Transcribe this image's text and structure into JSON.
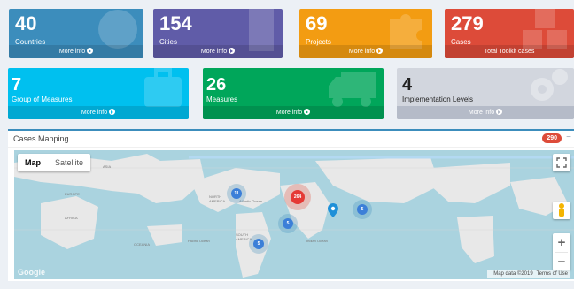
{
  "boxes": {
    "countries": {
      "value": "40",
      "label": "Countries",
      "footer": "More info"
    },
    "cities": {
      "value": "154",
      "label": "Cities",
      "footer": "More info"
    },
    "projects": {
      "value": "69",
      "label": "Projects",
      "footer": "More info"
    },
    "cases": {
      "value": "279",
      "label": "Cases",
      "footer": "Total Toolkit cases"
    },
    "group": {
      "value": "7",
      "label": "Group of Measures",
      "footer": "More info"
    },
    "measures": {
      "value": "26",
      "label": "Measures",
      "footer": "More info"
    },
    "levels": {
      "value": "4",
      "label": "Implementation Levels",
      "footer": "More info"
    }
  },
  "panel": {
    "title": "Cases Mapping",
    "badge": "290",
    "minimize": "−"
  },
  "map": {
    "tabs": [
      "Map",
      "Satellite"
    ],
    "zoom_in": "+",
    "zoom_out": "−",
    "logo": "Google",
    "attribution": "Map data ©2019",
    "terms": "Terms of Use",
    "markers": [
      {
        "label": "11"
      },
      {
        "label": "264"
      },
      {
        "label": "5"
      },
      {
        "label": "5"
      },
      {
        "label": "5"
      }
    ],
    "labels": {
      "asia": "ASIA",
      "europe": "EUROPE",
      "africa": "AFRICA",
      "north_america": "NORTH AMERICA",
      "south_america": "SOUTH AMERICA",
      "atlantic": "Atlantic Ocean",
      "indian": "Indian Ocean",
      "oceania": "OCEANIA",
      "pacific": "Pacific Ocean"
    }
  },
  "icons": [
    "globe-icon",
    "building-icon",
    "puzzle-icon",
    "cubes-icon",
    "briefcase-icon",
    "truck-icon",
    "gears-icon",
    "pegman-icon",
    "fullscreen-icon",
    "map-pin-icon"
  ]
}
